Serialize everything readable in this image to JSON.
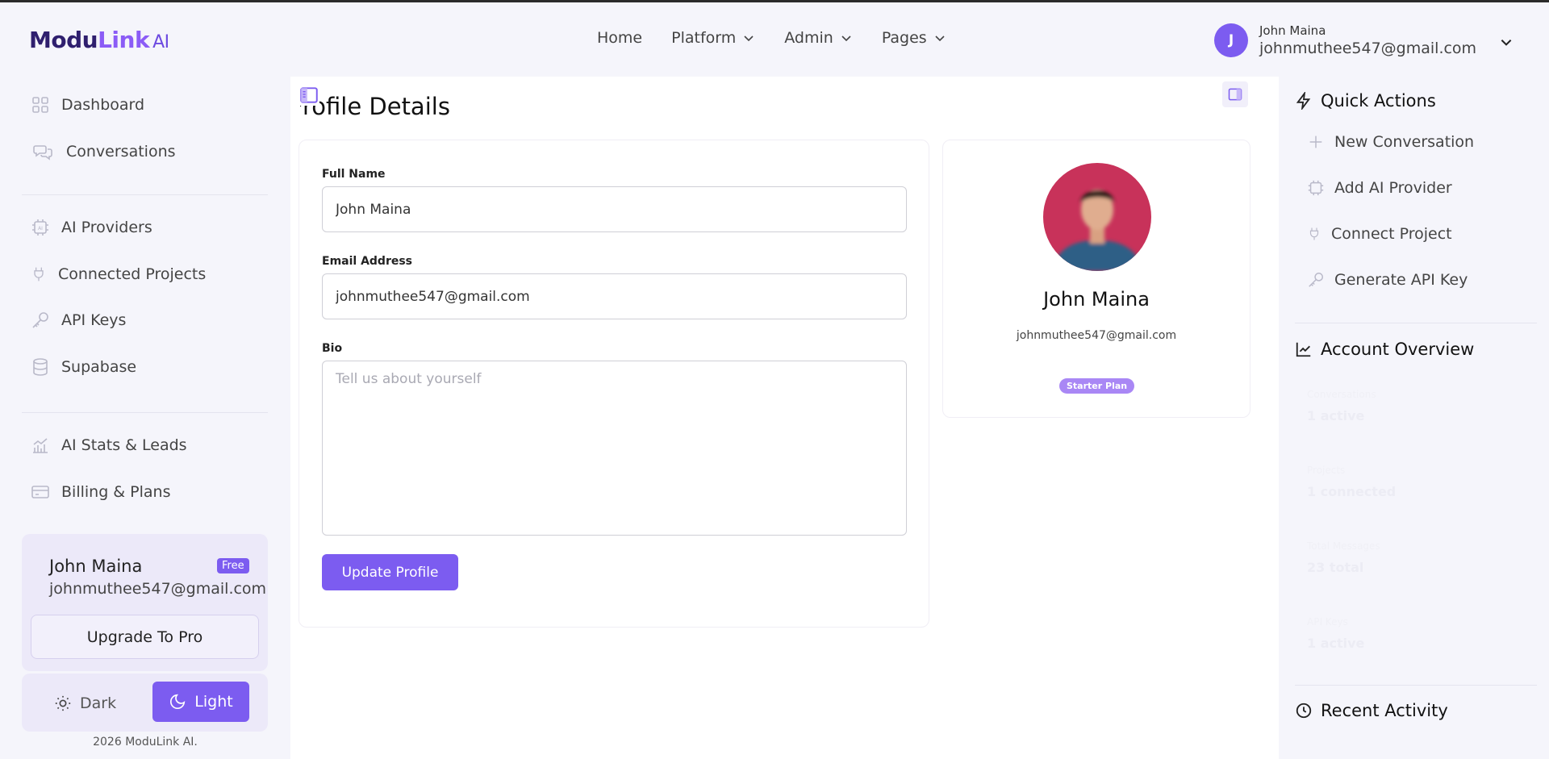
{
  "header": {
    "logo_main": "Modu",
    "logo_accent": "Link",
    "logo_suffix": "AI",
    "nav": [
      {
        "label": "Home"
      },
      {
        "label": "Platform"
      },
      {
        "label": "Admin"
      },
      {
        "label": "Pages"
      }
    ],
    "user": {
      "initial": "J",
      "name": "John Maina",
      "email": "johnmuthee547@gmail.com"
    }
  },
  "sidebar": {
    "items": [
      {
        "label": "Dashboard",
        "icon": "grid-icon"
      },
      {
        "label": "Conversations",
        "icon": "chat-icon"
      },
      {
        "label": "AI Providers",
        "icon": "chip-icon"
      },
      {
        "label": "Connected Projects",
        "icon": "plug-icon"
      },
      {
        "label": "API Keys",
        "icon": "key-icon"
      },
      {
        "label": "Supabase",
        "icon": "database-icon"
      },
      {
        "label": "AI Stats & Leads",
        "icon": "chart-icon"
      },
      {
        "label": "Billing & Plans",
        "icon": "credit-card-icon"
      }
    ],
    "user_card": {
      "name": "John Maina",
      "badge": "Free",
      "email": "johnmuthee547@gmail.com",
      "upgrade_label": "Upgrade To Pro"
    },
    "theme": {
      "dark_label": "Dark",
      "light_label": "Light",
      "active": "Light"
    },
    "copyright": "2026 ModuLink AI."
  },
  "main": {
    "title": "Profile Details",
    "form": {
      "full_name_label": "Full Name",
      "full_name_value": "John Maina",
      "email_label": "Email Address",
      "email_value": "johnmuthee547@gmail.com",
      "bio_label": "Bio",
      "bio_placeholder": "Tell us about yourself",
      "submit_label": "Update Profile"
    },
    "profile_card": {
      "name": "John Maina",
      "email": "johnmuthee547@gmail.com",
      "plan": "Starter Plan"
    }
  },
  "right_panel": {
    "quick_actions_title": "Quick Actions",
    "quick_actions": [
      {
        "label": "New Conversation",
        "icon": "plus-icon"
      },
      {
        "label": "Add AI Provider",
        "icon": "chip-icon"
      },
      {
        "label": "Connect Project",
        "icon": "plug-icon"
      },
      {
        "label": "Generate API Key",
        "icon": "key-icon"
      }
    ],
    "overview_title": "Account Overview",
    "overview": [
      {
        "label": "Conversations",
        "value": "1 active"
      },
      {
        "label": "Projects",
        "value": "1 connected"
      },
      {
        "label": "Total Messages",
        "value": "23 total"
      },
      {
        "label": "API Keys",
        "value": "1 active"
      }
    ],
    "recent_title": "Recent Activity"
  },
  "colors": {
    "accent": "#7c5cf0",
    "logo_dark": "#2f1f6e",
    "background": "#f5f5fb"
  }
}
